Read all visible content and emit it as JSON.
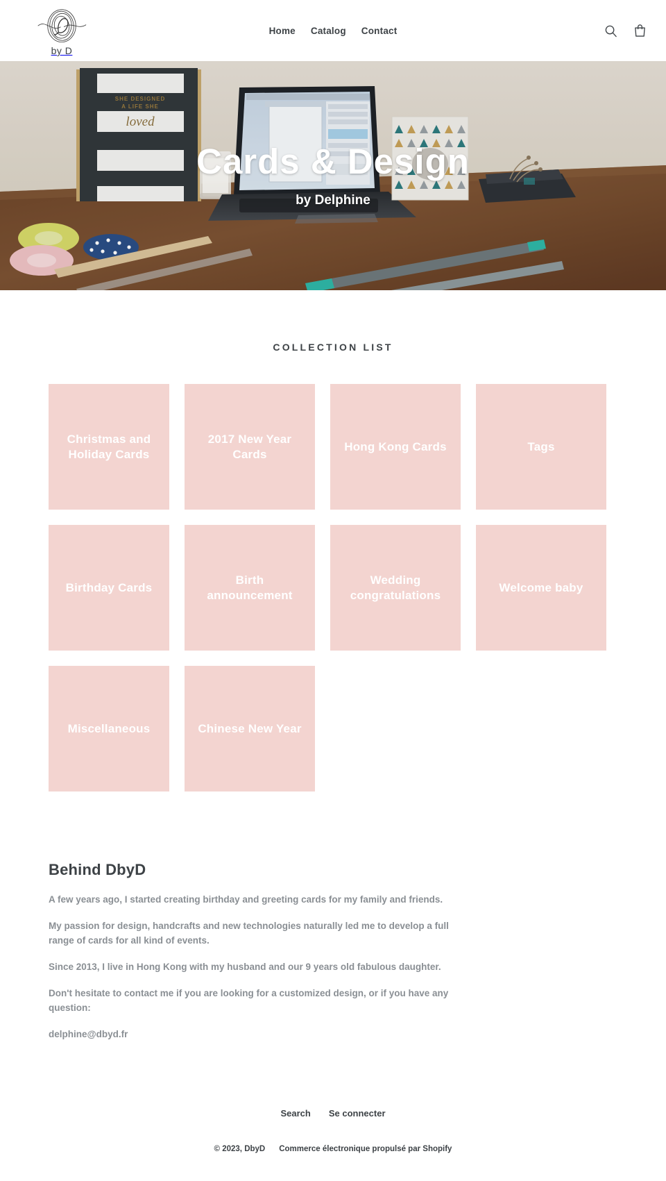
{
  "header": {
    "logo": {
      "monogram": "D",
      "subtitle": "by D",
      "alt": "DbyD logo"
    },
    "nav": [
      {
        "label": "Home"
      },
      {
        "label": "Catalog"
      },
      {
        "label": "Contact"
      }
    ],
    "icons": [
      {
        "name": "search-icon",
        "label": "Search"
      },
      {
        "name": "cart-icon",
        "label": "Cart"
      }
    ]
  },
  "hero": {
    "title": "Cards & Design",
    "subtitle": "by Delphine",
    "image_description": "Desk scene with open laptop, striped notebook reading SHE DESIGNED A LIFE SHE loved, candle, washi tape rolls and pens on a wooden table",
    "notebook_text_line1": "SHE DESIGNED",
    "notebook_text_line2": "A LIFE SHE",
    "notebook_text_line3": "loved"
  },
  "collections": {
    "heading": "Collection list",
    "tile_color": "#f3d4d0",
    "items": [
      {
        "label": "Christmas and Holiday Cards",
        "size": "a"
      },
      {
        "label": "2017 New Year Cards",
        "size": "b"
      },
      {
        "label": "Hong Kong Cards",
        "size": "b"
      },
      {
        "label": "Tags",
        "size": "b"
      },
      {
        "label": "Birthday Cards",
        "size": "a"
      },
      {
        "label": "Birth announcement",
        "size": "b"
      },
      {
        "label": "Wedding congratulations",
        "size": "b"
      },
      {
        "label": "Welcome baby",
        "size": "b"
      },
      {
        "label": "Miscellaneous",
        "size": "a"
      },
      {
        "label": "Chinese New Year",
        "size": "b"
      }
    ]
  },
  "behind": {
    "title": "Behind DbyD",
    "paragraphs": [
      "A few years ago, I started creating birthday and greeting cards for my family and friends.",
      "My passion for design, handcrafts and new technologies naturally led me to develop a full range of cards for all kind of events.",
      "Since 2013, I live in Hong Kong with my husband and our 9 years old fabulous daughter.",
      "Don't hesitate to contact me if you are looking for a customized design, or if you have any question:",
      "delphine@dbyd.fr"
    ]
  },
  "footer": {
    "links": [
      {
        "label": "Search"
      },
      {
        "label": "Se connecter"
      }
    ],
    "copyright": "© 2023, DbyD",
    "powered_by": "Commerce électronique propulsé par Shopify"
  }
}
